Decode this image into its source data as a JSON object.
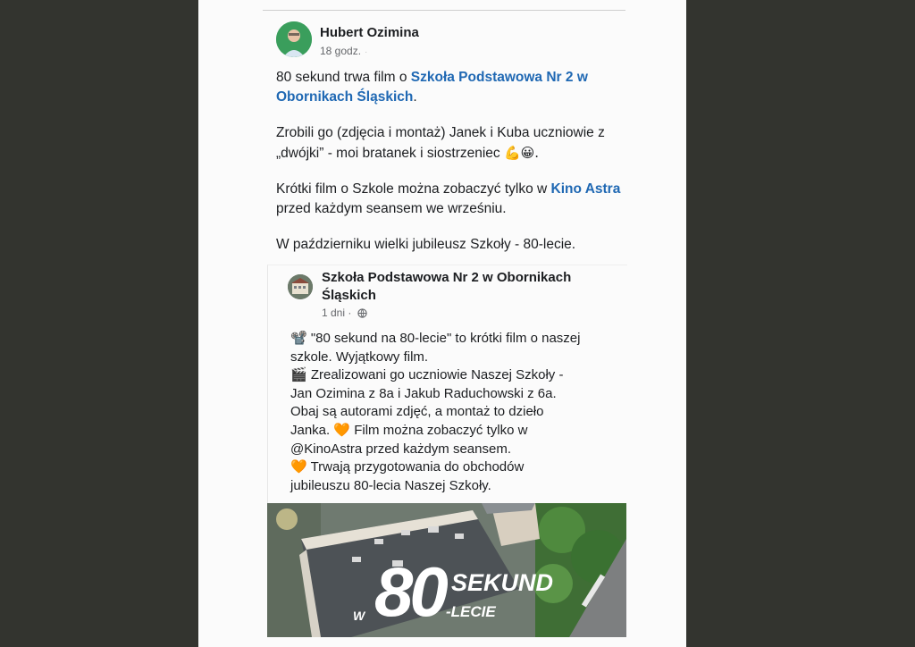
{
  "post": {
    "author": "Hubert Ozimina",
    "time": "18 godz.",
    "time_suffix": "·",
    "text": {
      "p1_pre": "80 sekund trwa film o ",
      "p1_link": "Szkoła Podstawowa Nr 2 w Obornikach Śląskich",
      "p1_post": ".",
      "p2": "Zrobili go (zdjęcia i montaż) Janek i Kuba uczniowie z „dwójki” - moi bratanek i siostrzeniec",
      "p2_emoji": "💪😀.",
      "p3_pre": "Krótki film o Szkole można zobaczyć tylko w ",
      "p3_link": "Kino Astra",
      "p3_post": " przed każdym seansem we wrześniu.",
      "p4": "W październiku wielki jubileusz Szkoły - 80-lecie."
    }
  },
  "shared_post": {
    "author": "Szkoła Podstawowa Nr 2 w Obornikach Śląskich",
    "time": "1 dni ·",
    "globe_icon": "globe-icon",
    "lines": [
      "📽️ \"80 sekund na 80-lecie\" to krótki film o naszej",
      "szkole. Wyjątkowy film.",
      "🎬 Zrealizowani go uczniowie Naszej Szkoły -",
      "Jan Ozimina z 8a i Jakub Raduchowski z 6a.",
      "Obaj są autorami zdjęć, a montaż to dzieło",
      "Janka. 🧡 Film można zobaczyć tylko w",
      "@KinoAstra przed każdym seansem.",
      "🧡 Trwają przygotowania do obchodów",
      "jubileuszu 80-lecia Naszej Szkoły."
    ]
  },
  "photo": {
    "number": "80",
    "word_top": "SEKUND",
    "word_bottom": "-LECIE",
    "word_left": "W"
  },
  "colors": {
    "link": "#1f68b3",
    "background": "#33342f",
    "paper": "#fbfbfb"
  }
}
